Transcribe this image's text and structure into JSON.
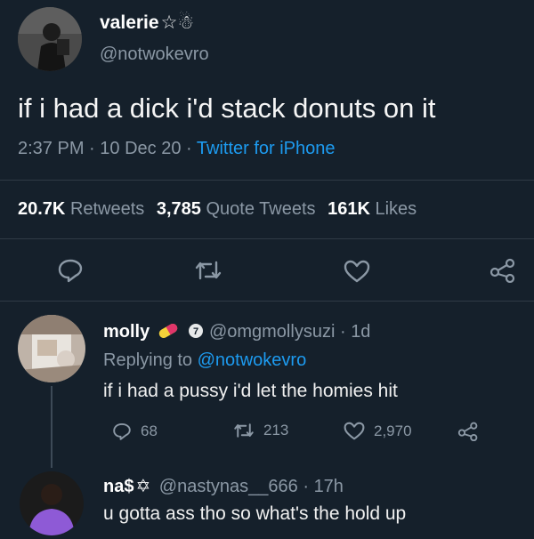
{
  "main_tweet": {
    "display_name": "valerie",
    "name_emojis": "☆☃",
    "handle": "@notwokevro",
    "text": "if i had a dick i'd stack donuts on it",
    "time": "2:37 PM",
    "date": "10 Dec 20",
    "source": "Twitter for iPhone",
    "stats": {
      "retweets_count": "20.7K",
      "retweets_label": "Retweets",
      "quotes_count": "3,785",
      "quotes_label": "Quote Tweets",
      "likes_count": "161K",
      "likes_label": "Likes"
    }
  },
  "replies": [
    {
      "display_name": "molly",
      "handle": "@omgmollysuzi",
      "age": "1d",
      "replying_to_label": "Replying to",
      "replying_to_handle": "@notwokevro",
      "text": "if i had a pussy i'd let the homies hit",
      "reply_count": "68",
      "retweet_count": "213",
      "like_count": "2,970"
    },
    {
      "display_name": "na$",
      "name_emoji": "✡",
      "handle": "@nastynas__666",
      "age": "17h",
      "text": "u gotta ass tho so what's the hold up"
    }
  ],
  "separator": "·",
  "colors": {
    "background": "#15202b",
    "muted": "#8b98a5",
    "link": "#1d9bf0",
    "text": "#e7e9ea"
  }
}
